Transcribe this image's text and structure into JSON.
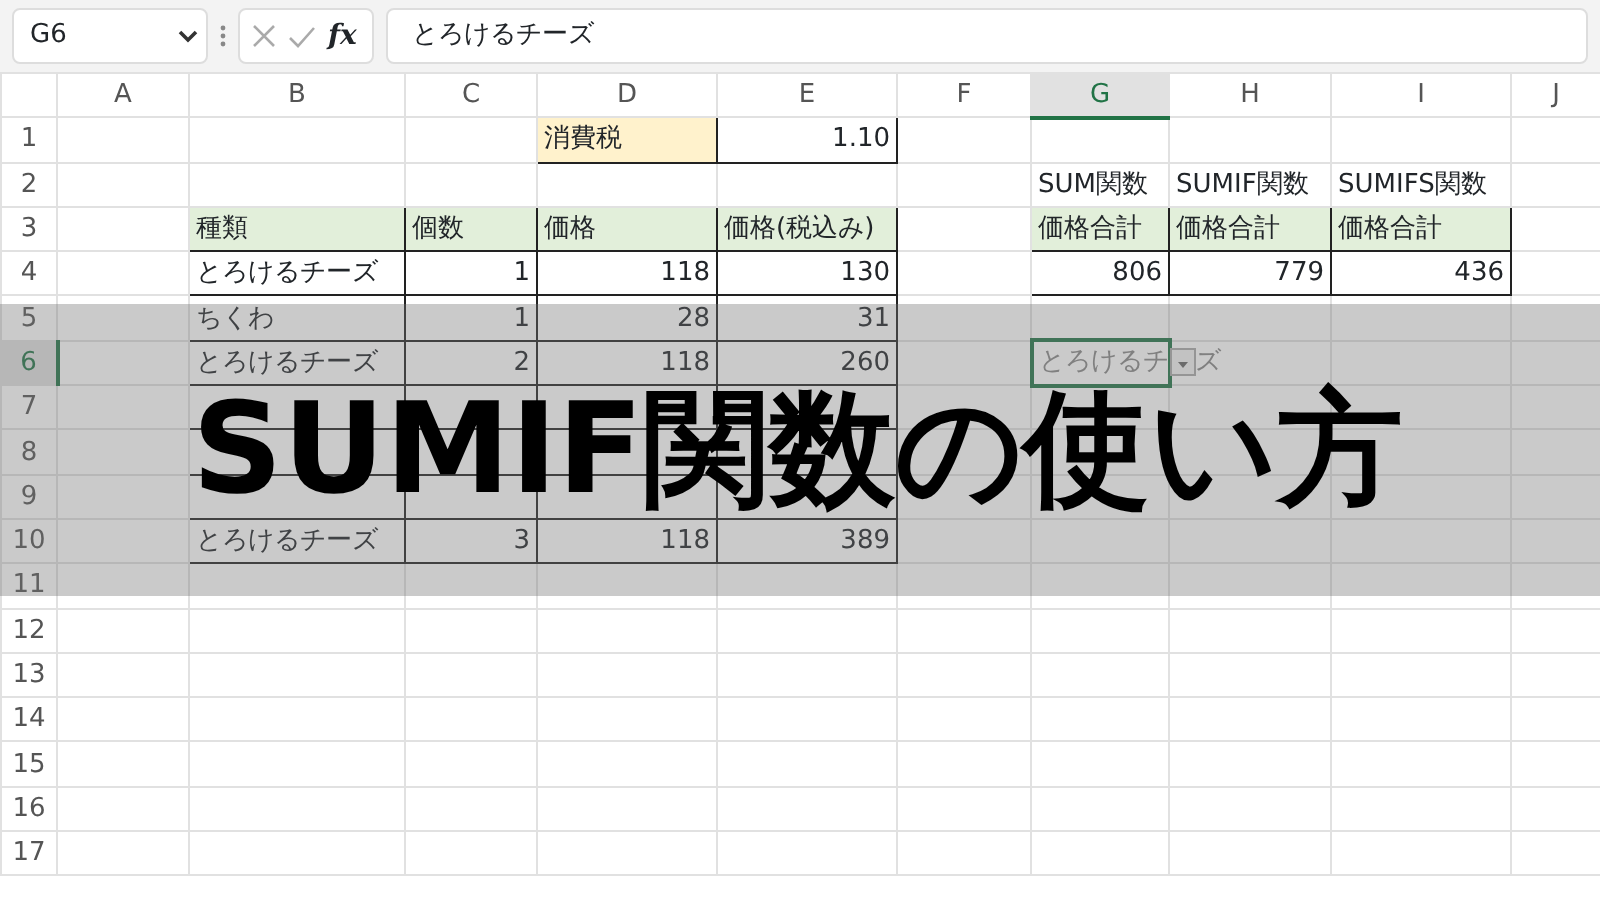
{
  "formula_bar": {
    "name_box": "G6",
    "function_label": "fx",
    "formula": "とろけるチーズ"
  },
  "columns": [
    {
      "label": "A",
      "selected": false
    },
    {
      "label": "B",
      "selected": false
    },
    {
      "label": "C",
      "selected": false
    },
    {
      "label": "D",
      "selected": false
    },
    {
      "label": "E",
      "selected": false
    },
    {
      "label": "F",
      "selected": false
    },
    {
      "label": "G",
      "selected": true
    },
    {
      "label": "H",
      "selected": false
    },
    {
      "label": "I",
      "selected": false
    },
    {
      "label": "J",
      "selected": false
    }
  ],
  "rows": [
    {
      "number": "1",
      "selected": false,
      "cells": [
        {
          "kind": "empty"
        },
        {
          "kind": "empty"
        },
        {
          "kind": "empty"
        },
        {
          "kind": "tax-label",
          "text": "消費税"
        },
        {
          "kind": "number",
          "text": "1.10"
        }
      ]
    },
    {
      "number": "2",
      "selected": false,
      "cells": [
        {
          "kind": "empty"
        },
        {
          "kind": "empty"
        },
        {
          "kind": "empty"
        },
        {
          "kind": "empty"
        },
        {
          "kind": "empty"
        },
        {
          "kind": "empty"
        },
        {
          "kind": "caption",
          "text": "SUM関数"
        },
        {
          "kind": "caption",
          "text": "SUMIF関数"
        },
        {
          "kind": "caption",
          "text": "SUMIFS関数"
        }
      ]
    },
    {
      "number": "3",
      "selected": false,
      "cells": [
        {
          "kind": "empty"
        },
        {
          "kind": "header",
          "text": "種類"
        },
        {
          "kind": "header",
          "text": "個数"
        },
        {
          "kind": "header",
          "text": "価格"
        },
        {
          "kind": "header",
          "text": "価格(税込み)"
        },
        {
          "kind": "empty"
        },
        {
          "kind": "header",
          "text": "価格合計"
        },
        {
          "kind": "header",
          "text": "価格合計"
        },
        {
          "kind": "header",
          "text": "価格合計"
        }
      ]
    },
    {
      "number": "4",
      "selected": false,
      "cells": [
        {
          "kind": "empty"
        },
        {
          "kind": "text",
          "text": "とろけるチーズ"
        },
        {
          "kind": "number",
          "text": "1"
        },
        {
          "kind": "number",
          "text": "118"
        },
        {
          "kind": "number",
          "text": "130"
        },
        {
          "kind": "empty"
        },
        {
          "kind": "number",
          "text": "806"
        },
        {
          "kind": "number",
          "text": "779"
        },
        {
          "kind": "number",
          "text": "436"
        }
      ]
    },
    {
      "number": "5",
      "selected": false,
      "cells": [
        {
          "kind": "empty"
        },
        {
          "kind": "text",
          "text": "ちくわ"
        },
        {
          "kind": "number",
          "text": "1"
        },
        {
          "kind": "number",
          "text": "28"
        },
        {
          "kind": "number",
          "text": "31"
        }
      ]
    },
    {
      "number": "6",
      "selected": true,
      "cells": [
        {
          "kind": "empty"
        },
        {
          "kind": "text",
          "text": "とろけるチーズ"
        },
        {
          "kind": "number",
          "text": "2"
        },
        {
          "kind": "number",
          "text": "118"
        },
        {
          "kind": "number",
          "text": "260"
        },
        {
          "kind": "empty"
        },
        {
          "kind": "autocomplete",
          "text": "とろけるチ",
          "rest": "ズ"
        }
      ]
    },
    {
      "number": "7",
      "selected": false,
      "cells": [
        {
          "kind": "empty"
        },
        {
          "kind": "text"
        },
        {
          "kind": "number"
        },
        {
          "kind": "number"
        },
        {
          "kind": "number"
        }
      ]
    },
    {
      "number": "8",
      "selected": false,
      "cells": [
        {
          "kind": "empty"
        },
        {
          "kind": "text"
        },
        {
          "kind": "number"
        },
        {
          "kind": "number"
        },
        {
          "kind": "number"
        }
      ]
    },
    {
      "number": "9",
      "selected": false,
      "cells": [
        {
          "kind": "empty"
        },
        {
          "kind": "text"
        },
        {
          "kind": "number"
        },
        {
          "kind": "number"
        },
        {
          "kind": "number"
        }
      ]
    },
    {
      "number": "10",
      "selected": false,
      "cells": [
        {
          "kind": "empty"
        },
        {
          "kind": "text",
          "text": "とろけるチーズ"
        },
        {
          "kind": "number",
          "text": "3"
        },
        {
          "kind": "number",
          "text": "118"
        },
        {
          "kind": "number",
          "text": "389"
        }
      ]
    },
    {
      "number": "11",
      "selected": false
    },
    {
      "number": "12",
      "selected": false
    },
    {
      "number": "13",
      "selected": false
    },
    {
      "number": "14",
      "selected": false
    },
    {
      "number": "15",
      "selected": false
    },
    {
      "number": "16",
      "selected": false
    },
    {
      "number": "17",
      "selected": false
    }
  ],
  "banner": {
    "title": "SUMIF関数の使い方"
  }
}
